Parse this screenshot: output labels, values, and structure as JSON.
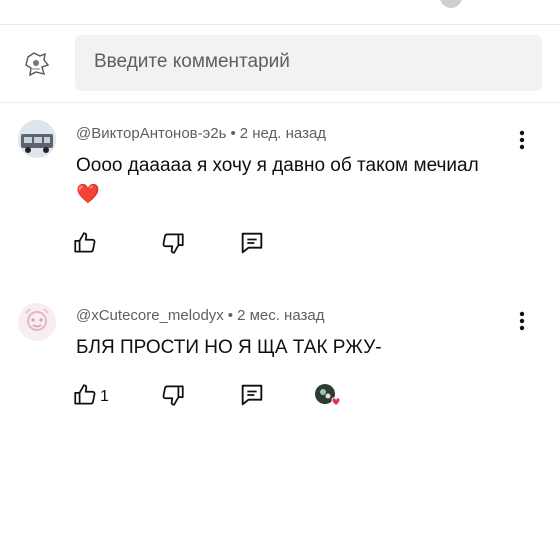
{
  "composer": {
    "placeholder": "Введите комментарий"
  },
  "comments": [
    {
      "author": "@ВикторАнтонов-э2ь",
      "time": "2 нед. назад",
      "text": "Оооо дааааа я хочу я давно об таком мечиал❤️",
      "likes": ""
    },
    {
      "author": "@xCutecore_melodyx",
      "time": "2 мес. назад",
      "text": "БЛЯ ПРОСТИ НО Я ЩА ТАК РЖУ-",
      "likes": "1"
    }
  ],
  "icons": {
    "like": "thumbs-up-icon",
    "dislike": "thumbs-down-icon",
    "reply": "reply-comment-icon",
    "more": "more-vertical-icon",
    "creator_heart": "creator-heart-icon"
  },
  "colors": {
    "text": "#0f0f0f",
    "meta": "#606060",
    "input_bg": "#f2f2f2",
    "heart": "#e5334a"
  }
}
